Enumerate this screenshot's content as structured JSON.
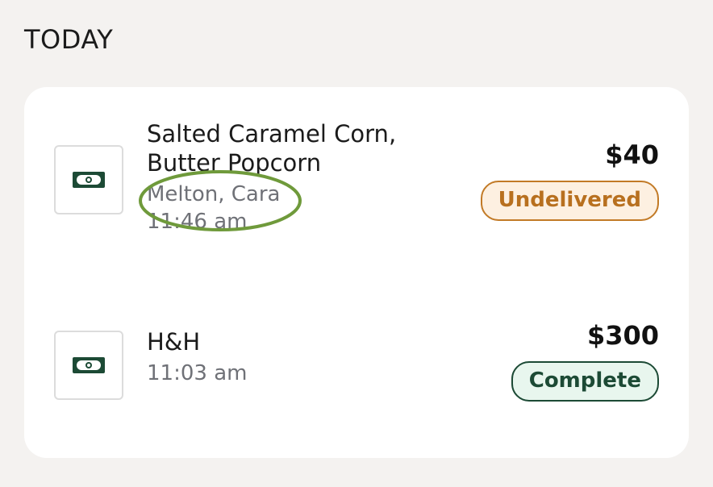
{
  "section": {
    "heading": "TODAY"
  },
  "transactions": [
    {
      "icon": "cash-icon",
      "title": "Salted Caramel Corn, Butter Popcorn",
      "customer": "Melton, Cara",
      "time": "11:46 am",
      "amount": "$40",
      "status": "Undelivered",
      "status_color": "#c27a26"
    },
    {
      "icon": "cash-icon",
      "title": "H&H",
      "time": "11:03 am",
      "amount": "$300",
      "status": "Complete",
      "status_color": "#1c4a35"
    }
  ],
  "colors": {
    "background": "#f4f2f0",
    "card": "#ffffff",
    "money_icon": "#1c4a35",
    "annotation": "#6f9a3b"
  }
}
